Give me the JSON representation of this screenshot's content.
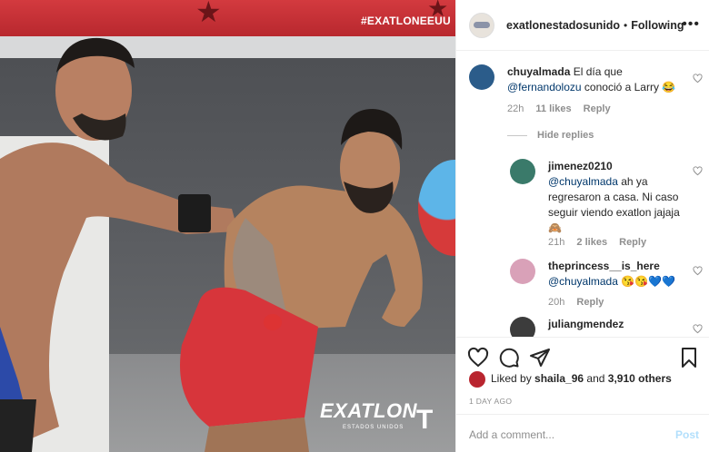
{
  "photo": {
    "hashtag": "#EXATLONEEUU",
    "logo_text": "EXATLON",
    "logo_subtext": "ESTADOS UNIDOS",
    "network_logo": "T"
  },
  "header": {
    "username": "exatlonestadosunido",
    "separator": "•",
    "follow_status": "Following",
    "more_icon": "more-horizontal-icon"
  },
  "comments": [
    {
      "username": "chuyalmada",
      "text_before": "El día que ",
      "mention": "@fernandolozu",
      "text_after": " conoció a Larry 😂",
      "time": "22h",
      "likes": "11 likes",
      "reply": "Reply"
    }
  ],
  "hide_replies": "Hide replies",
  "replies": [
    {
      "username": "jimenez0210",
      "mention": "@chuyalmada",
      "text": " ah ya regresaron a casa. Ni caso seguir viendo exatlon jajaja 🙈",
      "time": "21h",
      "likes": "2 likes",
      "reply": "Reply"
    },
    {
      "username": "theprincess__is_here",
      "mention": "@chuyalmada",
      "text": " 😘😘💙💙",
      "time": "20h",
      "reply": "Reply"
    },
    {
      "username": "juliangmendez"
    }
  ],
  "actions": {
    "like_icon": "heart-icon",
    "comment_icon": "comment-icon",
    "share_icon": "share-icon",
    "save_icon": "bookmark-icon"
  },
  "likes": {
    "prefix": "Liked by ",
    "user": "shaila_96",
    "middle": " and ",
    "others": "3,910 others"
  },
  "date": "1 DAY AGO",
  "add_comment": {
    "placeholder": "Add a comment...",
    "post_label": "Post"
  },
  "colors": {
    "link": "#00376b",
    "muted": "#8e8e8e",
    "post_disabled": "#b2dffc"
  }
}
